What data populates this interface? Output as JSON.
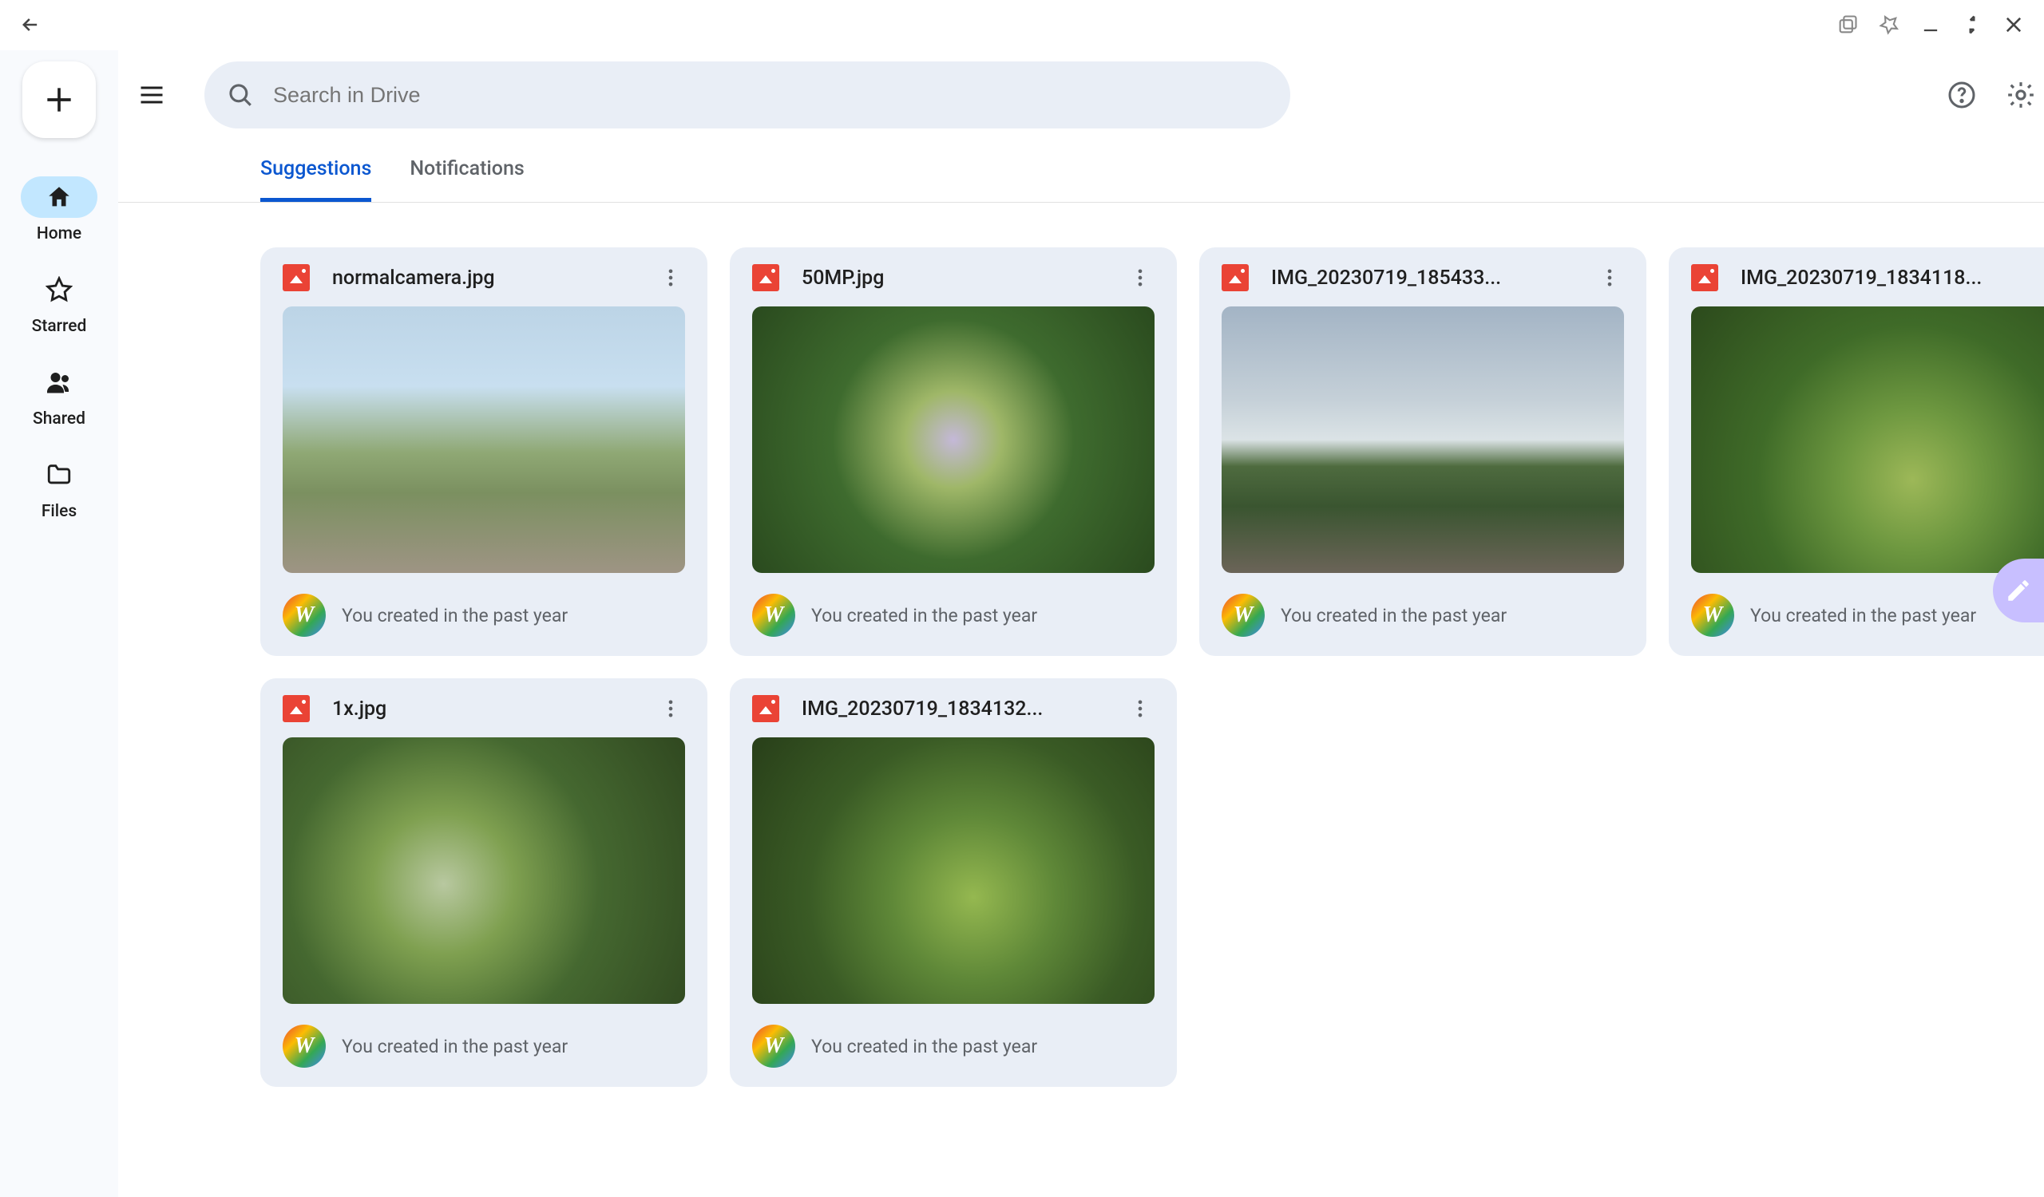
{
  "chrome": {
    "back": "back"
  },
  "search": {
    "placeholder": "Search in Drive"
  },
  "sidebar": {
    "items": [
      {
        "id": "home",
        "label": "Home",
        "active": true
      },
      {
        "id": "starred",
        "label": "Starred",
        "active": false
      },
      {
        "id": "shared",
        "label": "Shared",
        "active": false
      },
      {
        "id": "files",
        "label": "Files",
        "active": false
      }
    ]
  },
  "tabs": [
    {
      "label": "Suggestions",
      "active": true
    },
    {
      "label": "Notifications",
      "active": false
    }
  ],
  "avatar_letter": "W",
  "files": [
    {
      "name": "normalcamera.jpg",
      "meta": "You created in the past year",
      "thumb_css": "linear-gradient(180deg,#bcd4e6 0%,#c8dff0 30%,#8fa874 55%,#7b9060 70%,#9e9484 100%)"
    },
    {
      "name": "50MP.jpg",
      "meta": "You created in the past year",
      "thumb_css": "radial-gradient(circle at 50% 50%, #c4b8d8 0%, #9fb768 20%, #3e6b2e 50%, #2a4a1e 100%)"
    },
    {
      "name": "IMG_20230719_185433...",
      "meta": "You created in the past year",
      "thumb_css": "linear-gradient(180deg,#a3b4c5 0%,#c5d0d8 35%,#dbe3e6 50%,#4e6b3f 60%,#3a5530 75%,#6b6458 100%)"
    },
    {
      "name": "IMG_20230719_1834118...",
      "meta": "You created in the past year",
      "thumb_css": "radial-gradient(circle at 55% 65%, #9db858 0%, #6e9840 25%, #3f6b28 55%, #2c4a1c 100%)"
    },
    {
      "name": "1x.jpg",
      "meta": "You created in the past year",
      "thumb_css": "radial-gradient(circle at 40% 55%, #b8c8a0 0%, #7fa050 25%, #456830 55%, #304820 100%)"
    },
    {
      "name": "IMG_20230719_1834132...",
      "meta": "You created in the past year",
      "thumb_css": "radial-gradient(circle at 55% 60%, #95b850 0%, #5f8838 30%, #3a5b25 60%, #283f19 100%)"
    }
  ]
}
